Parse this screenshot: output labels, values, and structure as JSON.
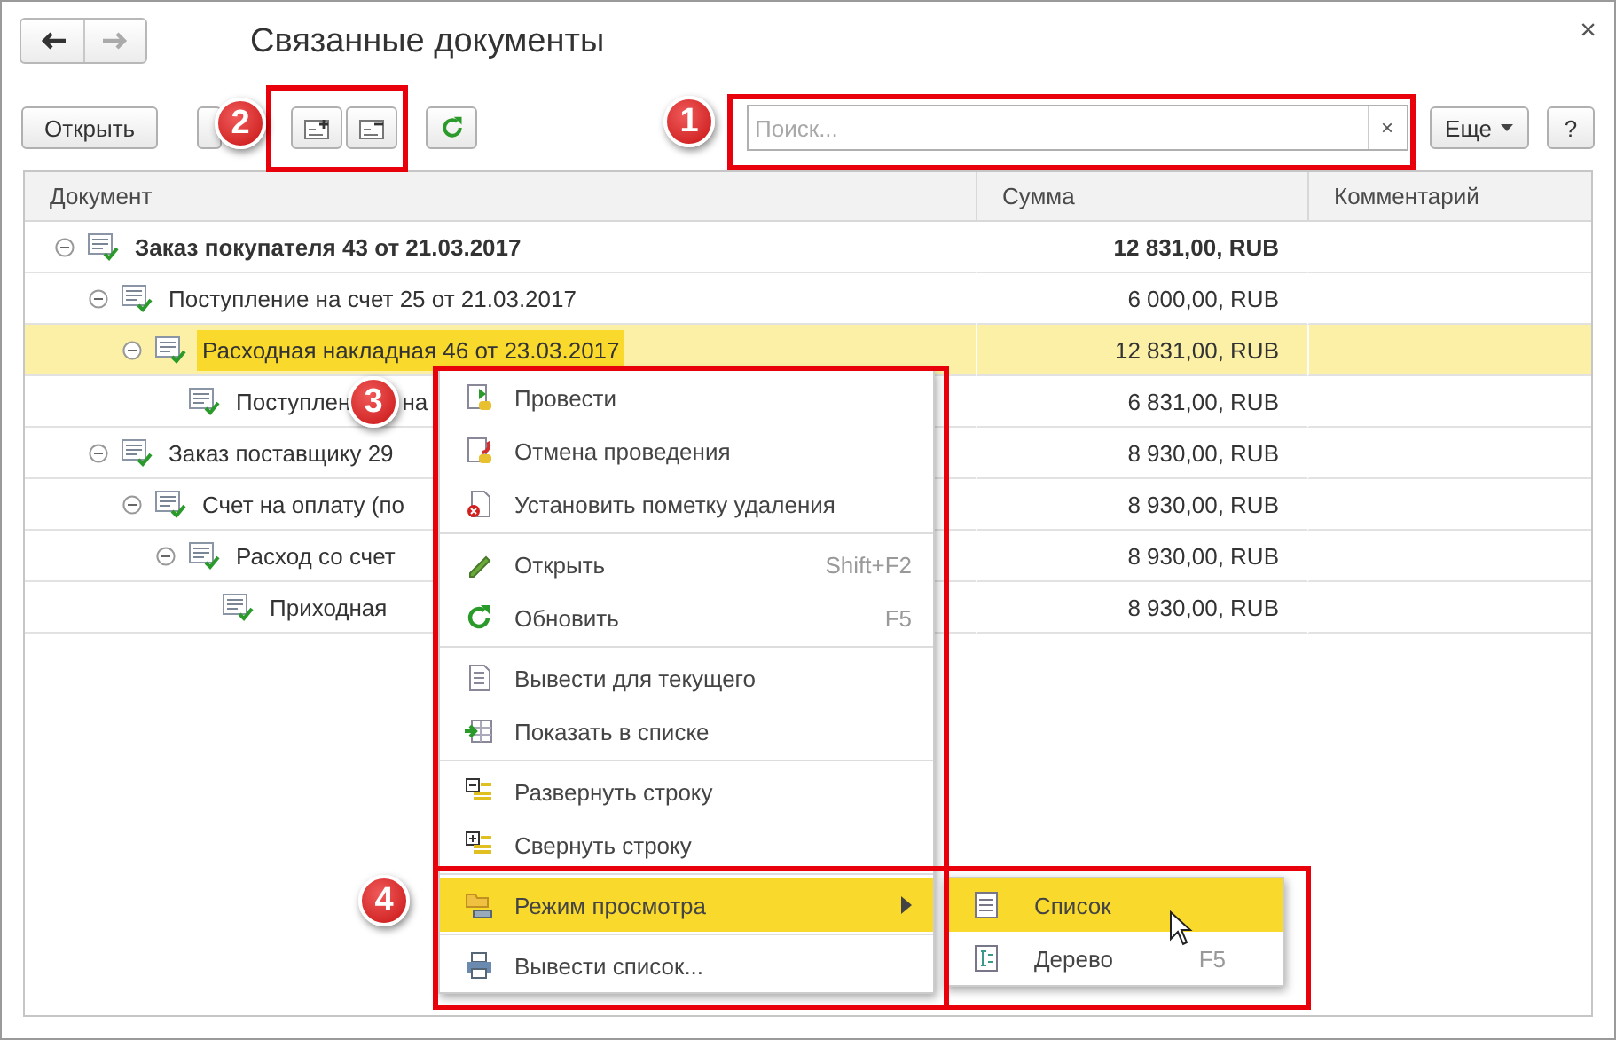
{
  "window": {
    "title": "Связанные документы",
    "close": "×"
  },
  "toolbar": {
    "open_button": "Открыть",
    "search": {
      "placeholder": "Поиск...",
      "clear": "×"
    },
    "more_button": "Еще",
    "help_button": "?"
  },
  "table": {
    "columns": [
      "Документ",
      "Сумма",
      "Комментарий"
    ],
    "rows": [
      {
        "document": "Заказ покупателя 43 от 21.03.2017",
        "amount": "12 831,00, RUB",
        "bold": true,
        "selected": false,
        "expanded": true,
        "children": [
          {
            "document": "Поступление на счет 25 от 21.03.2017",
            "amount": "6 000,00, RUB",
            "bold": false,
            "selected": false,
            "expanded": true,
            "children": [
              {
                "document": "Расходная накладная 46 от 23.03.2017",
                "amount": "12 831,00, RUB",
                "bold": false,
                "selected": true,
                "expanded": true,
                "children": [
                  {
                    "document": "Поступлен",
                    "document_tail": "на",
                    "amount": "6 831,00, RUB",
                    "bold": false,
                    "selected": false
                  }
                ]
              }
            ]
          },
          {
            "document": "Заказ поставщику 29",
            "amount": "8 930,00, RUB",
            "bold": false,
            "selected": false,
            "expanded": true,
            "children": [
              {
                "document": "Счет на оплату (по",
                "amount": "8 930,00, RUB",
                "bold": false,
                "selected": false,
                "expanded": true,
                "children": [
                  {
                    "document": "Расход со счет",
                    "amount": "8 930,00, RUB",
                    "bold": false,
                    "selected": false,
                    "expanded": true,
                    "children": [
                      {
                        "document": "Приходная",
                        "amount": "8 930,00, RUB",
                        "bold": false,
                        "selected": false
                      }
                    ]
                  }
                ]
              }
            ]
          }
        ]
      }
    ]
  },
  "context_menu": [
    {
      "kind": "item",
      "label": "Провести",
      "selected": false
    },
    {
      "kind": "item",
      "label": "Отмена проведения",
      "selected": false
    },
    {
      "kind": "item",
      "label": "Установить пометку удаления",
      "selected": false
    },
    {
      "kind": "separator"
    },
    {
      "kind": "item",
      "label": "Открыть",
      "shortcut": "Shift+F2",
      "selected": false
    },
    {
      "kind": "item",
      "label": "Обновить",
      "shortcut": "F5",
      "selected": false
    },
    {
      "kind": "separator"
    },
    {
      "kind": "item",
      "label": "Вывести для текущего",
      "selected": false
    },
    {
      "kind": "item",
      "label": "Показать в списке",
      "selected": false
    },
    {
      "kind": "separator"
    },
    {
      "kind": "item",
      "label": "Развернуть строку",
      "selected": false
    },
    {
      "kind": "item",
      "label": "Свернуть строку",
      "selected": false
    },
    {
      "kind": "separator"
    },
    {
      "kind": "submenu",
      "label": "Режим просмотра",
      "selected": true
    },
    {
      "kind": "separator"
    },
    {
      "kind": "item",
      "label": "Вывести список...",
      "selected": false
    }
  ],
  "submenu": [
    {
      "label": "Список",
      "selected": true
    },
    {
      "label": "Дерево",
      "shortcut": "F5",
      "selected": false
    }
  ],
  "annotations": [
    {
      "label": "1"
    },
    {
      "label": "2"
    },
    {
      "label": "3"
    },
    {
      "label": "4"
    }
  ]
}
